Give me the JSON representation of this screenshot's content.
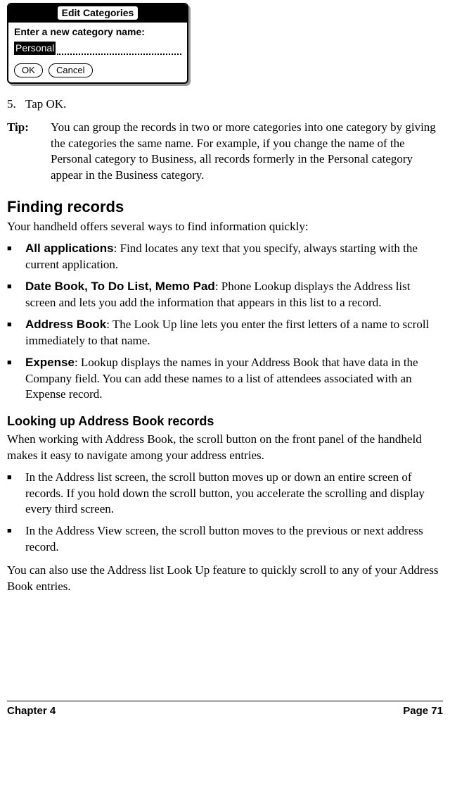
{
  "dialog": {
    "title": "Edit Categories",
    "prompt": "Enter a new category name:",
    "value": "Personal",
    "ok": "OK",
    "cancel": "Cancel"
  },
  "step5": {
    "num": "5.",
    "text": "Tap OK."
  },
  "tip": {
    "label": "Tip:",
    "text": "You can group the records in two or more categories into one category by giving the categories the same name. For example, if you change the name of the Personal category to Business, all records formerly in the Personal category appear in the Business category."
  },
  "section1": {
    "heading": "Finding records",
    "intro": "Your handheld offers several ways to find information quickly:",
    "items": [
      {
        "b": "All applications",
        "t": ": Find locates any text that you specify, always starting with the current application."
      },
      {
        "b": "Date Book, To Do List, Memo Pad",
        "t": ": Phone Lookup displays the Address list screen and lets you add the information that appears in this list to a record."
      },
      {
        "b": "Address Book",
        "t": ": The Look Up line lets you enter the first letters of a name to scroll immediately to that name."
      },
      {
        "b": "Expense",
        "t": ": Lookup displays the names in your Address Book that have data in the Company field. You can add these names to a list of attendees associated with an Expense record."
      }
    ]
  },
  "section2": {
    "heading": "Looking up Address Book records",
    "intro": "When working with Address Book, the scroll button on the front panel of the handheld makes it easy to navigate among your address entries.",
    "items": [
      {
        "t": "In the Address list screen, the scroll button moves up or down an entire screen of records. If you hold down the scroll button, you accelerate the scrolling and display every third screen."
      },
      {
        "t": "In the Address View screen, the scroll button moves to the previous or next address record."
      }
    ],
    "outro": "You can also use the Address list Look Up feature to quickly scroll to any of your Address Book entries."
  },
  "footer": {
    "left": "Chapter 4",
    "right": "Page 71"
  }
}
